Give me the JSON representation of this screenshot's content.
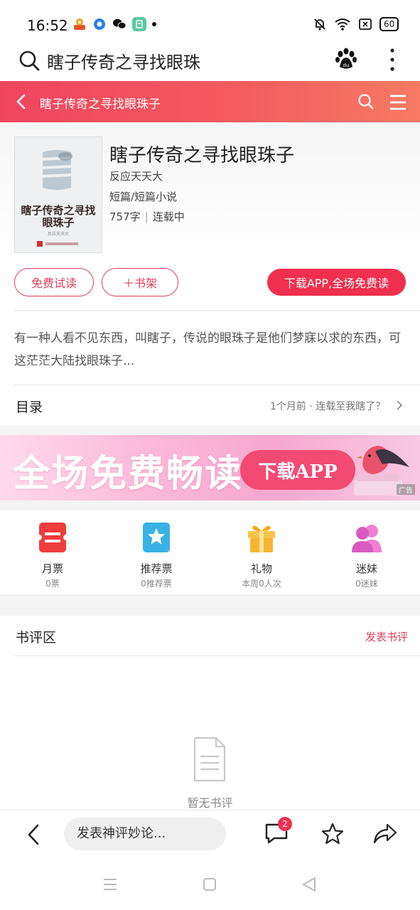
{
  "status_bar": {
    "time": "16:52",
    "battery": "60",
    "icons": [
      "bell-off-icon",
      "wifi-icon",
      "close-box-icon"
    ]
  },
  "browser": {
    "query": "瞎子传奇之寻找眼珠",
    "icons": [
      "search-icon",
      "baidu-paw-icon",
      "more-vertical-icon"
    ]
  },
  "header": {
    "title": "瞎子传奇之寻找眼珠子"
  },
  "book": {
    "cover_title": "瞎子传奇之寻找眼珠子",
    "title": "瞎子传奇之寻找眼珠子",
    "author": "反应天天大",
    "genre": "短篇/短篇小说",
    "word_count": "757字",
    "status": "连载中",
    "stats_separator": "|",
    "description": "有一种人看不见东西，叫瞎子，传说的眼珠子是他们梦寐以求的东西，可这茫茫大陆找眼珠子..."
  },
  "actions": {
    "free_trial": "免费试读",
    "add_shelf": "＋书架",
    "download": "下载APP,全场免费读"
  },
  "toc": {
    "title": "目录",
    "meta": "1个月前 · 连载至我瞎了？"
  },
  "banner": {
    "text": "全场免费畅读",
    "button": "下载APP",
    "ad_tag": "广告"
  },
  "tickets": [
    {
      "label": "月票",
      "sub": "0票",
      "color": "#f04040"
    },
    {
      "label": "推荐票",
      "sub": "0推荐票",
      "color": "#3db7e8"
    },
    {
      "label": "礼物",
      "sub": "本周0人次",
      "color": "#f7b430"
    },
    {
      "label": "迷妹",
      "sub": "0迷妹",
      "color": "#e668c8"
    }
  ],
  "reviews": {
    "title": "书评区",
    "post": "发表书评",
    "empty": "暂无书评"
  },
  "bottom_bar": {
    "comment_placeholder": "发表神评妙论...",
    "message_badge": "2"
  },
  "colors": {
    "accent": "#f0304e",
    "header_gradient": [
      "#f0455f",
      "#f77a64"
    ]
  }
}
